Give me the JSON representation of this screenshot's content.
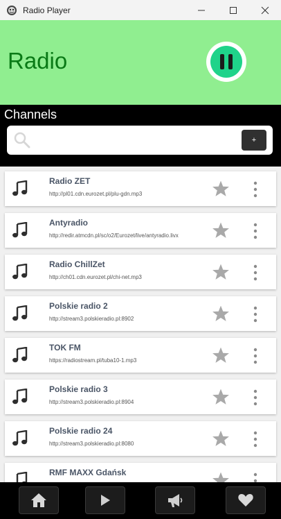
{
  "window": {
    "title": "Radio Player",
    "icon": "app-icon",
    "controls": [
      "minimize-icon",
      "maximize-icon",
      "close-icon"
    ]
  },
  "header": {
    "title": "Radio",
    "play_button_icon": "pause-icon",
    "bg_color": "#90ee90",
    "title_color": "#0a7a16",
    "accent_color": "#1fd38a"
  },
  "channels": {
    "title": "Channels",
    "search": {
      "placeholder": "",
      "value": "",
      "icon": "search-icon"
    },
    "add_button_label": "+"
  },
  "stations": [
    {
      "name": "Radio ZET",
      "url": "http://pl01.cdn.eurozet.pl/plu-gdn.mp3"
    },
    {
      "name": "Antyradio",
      "url": "http://redir.atmcdn.pl/sc/o2/Eurozet/live/antyradio.livx"
    },
    {
      "name": "Radio ChillZet",
      "url": "http://ch01.cdn.eurozet.pl/chi-net.mp3"
    },
    {
      "name": "Polskie radio 2",
      "url": "http://stream3.polskieradio.pl:8902"
    },
    {
      "name": "TOK FM",
      "url": "https://radiostream.pl/tuba10-1.mp3"
    },
    {
      "name": "Polskie radio 3",
      "url": "http://stream3.polskieradio.pl:8904"
    },
    {
      "name": "Polskie radio 24",
      "url": "http://stream3.polskieradio.pl:8080"
    },
    {
      "name": "RMF MAXX Gdańsk",
      "url": ""
    }
  ],
  "nav": [
    {
      "name": "home",
      "icon": "home-icon"
    },
    {
      "name": "play",
      "icon": "play-icon"
    },
    {
      "name": "announce",
      "icon": "megaphone-icon"
    },
    {
      "name": "favorites",
      "icon": "heart-icon"
    }
  ]
}
